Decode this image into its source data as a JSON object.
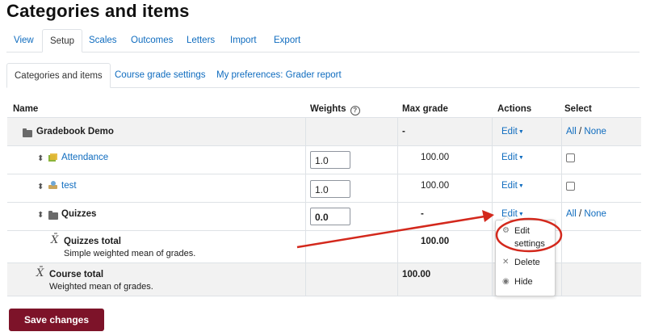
{
  "page": {
    "title": "Categories and items"
  },
  "tabs_primary": [
    {
      "label": "View"
    },
    {
      "label": "Setup"
    },
    {
      "label": "Scales"
    },
    {
      "label": "Outcomes"
    },
    {
      "label": "Letters"
    },
    {
      "label": "Import"
    },
    {
      "label": "Export"
    }
  ],
  "tabs_secondary": [
    {
      "label": "Categories and items"
    },
    {
      "label": "Course grade settings"
    },
    {
      "label": "My preferences: Grader report"
    }
  ],
  "table": {
    "headers": {
      "name": "Name",
      "weights": "Weights",
      "max_grade": "Max grade",
      "actions": "Actions",
      "select": "Select"
    },
    "rows": {
      "gradebook": {
        "name": "Gradebook Demo",
        "max": "-",
        "edit": "Edit",
        "all": "All",
        "sep": "/",
        "none": "None"
      },
      "attendance": {
        "name": "Attendance",
        "weight": "1.0",
        "max": "100.00",
        "edit": "Edit"
      },
      "test": {
        "name": "test",
        "weight": "1.0",
        "max": "100.00",
        "edit": "Edit"
      },
      "quizzes": {
        "name": "Quizzes",
        "weight": "0.0",
        "max": "-",
        "edit": "Edit",
        "all": "All",
        "sep": "/",
        "none": "None"
      },
      "quizzes_total": {
        "name": "Quizzes total",
        "desc": "Simple weighted mean of grades.",
        "max": "100.00"
      },
      "course_total": {
        "name": "Course total",
        "desc": "Weighted mean of grades.",
        "max": "100.00"
      }
    }
  },
  "menu": {
    "edit_settings_line1": "Edit",
    "edit_settings_line2": "settings",
    "delete": "Delete",
    "hide": "Hide"
  },
  "icons": {
    "move": "move-icon",
    "folder": "folder-icon",
    "attendance": "attendance-icon",
    "quiz": "quiz-icon",
    "sigma": "x-bar-icon",
    "help": "help-icon",
    "gear": "gear-icon",
    "delete": "delete-icon",
    "hide": "eye-icon"
  },
  "colors": {
    "link": "#0f6cbf",
    "button": "#7d1329",
    "annotation": "#d3281c"
  },
  "footer": {
    "save_label": "Save changes"
  }
}
